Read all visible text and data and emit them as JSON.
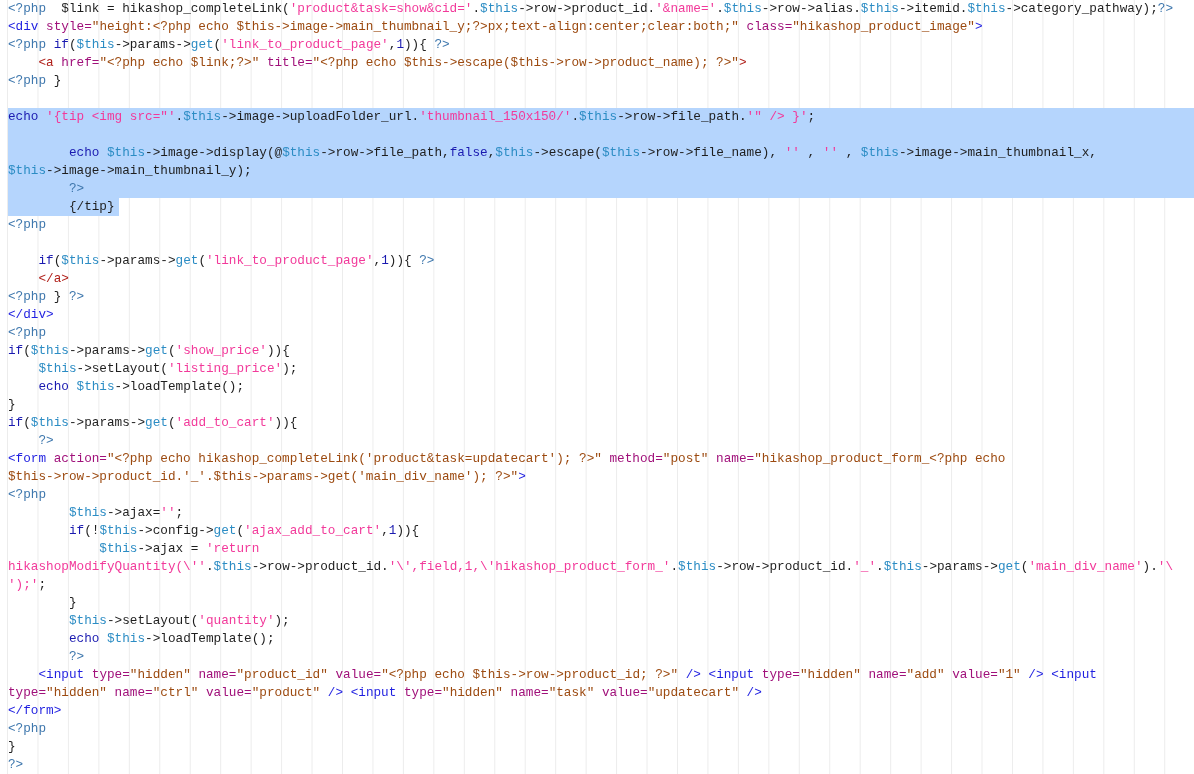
{
  "editor": {
    "lines": [
      {
        "selected": false,
        "tokens": [
          {
            "kind": "php",
            "text": "<?php"
          },
          {
            "kind": "plain",
            "text": "  $link = hikashop_completeLink("
          },
          {
            "kind": "string",
            "text": "'product&task=show&cid='"
          },
          {
            "kind": "plain",
            "text": "."
          },
          {
            "kind": "variable",
            "text": "$this"
          },
          {
            "kind": "plain",
            "text": "->row->product_id."
          },
          {
            "kind": "string",
            "text": "'&name='"
          },
          {
            "kind": "plain",
            "text": "."
          },
          {
            "kind": "variable",
            "text": "$this"
          },
          {
            "kind": "plain",
            "text": "->row->alias."
          },
          {
            "kind": "variable",
            "text": "$this"
          },
          {
            "kind": "plain",
            "text": "->itemid."
          },
          {
            "kind": "variable",
            "text": "$this"
          },
          {
            "kind": "plain",
            "text": "->category_pathway);"
          },
          {
            "kind": "php",
            "text": "?>"
          }
        ]
      },
      {
        "selected": false,
        "tokens": [
          {
            "kind": "tag",
            "text": "<div "
          },
          {
            "kind": "attr",
            "text": "style="
          },
          {
            "kind": "value",
            "text": "\"height:<?php echo $this->image->main_thumbnail_y;?>px;text-align:center;clear:both;\" "
          },
          {
            "kind": "attr",
            "text": "class="
          },
          {
            "kind": "value",
            "text": "\"hikashop_product_image\""
          },
          {
            "kind": "tag",
            "text": ">"
          }
        ]
      },
      {
        "selected": false,
        "tokens": [
          {
            "kind": "php",
            "text": "<?php "
          },
          {
            "kind": "keyword",
            "text": "if"
          },
          {
            "kind": "plain",
            "text": "("
          },
          {
            "kind": "variable",
            "text": "$this"
          },
          {
            "kind": "plain",
            "text": "->params->"
          },
          {
            "kind": "func",
            "text": "get"
          },
          {
            "kind": "plain",
            "text": "("
          },
          {
            "kind": "string",
            "text": "'link_to_product_page'"
          },
          {
            "kind": "plain",
            "text": ","
          },
          {
            "kind": "number",
            "text": "1"
          },
          {
            "kind": "plain",
            "text": ")){ "
          },
          {
            "kind": "php",
            "text": "?>"
          }
        ]
      },
      {
        "selected": false,
        "tokens": [
          {
            "kind": "anchor",
            "text": "    <a "
          },
          {
            "kind": "attr",
            "text": "href="
          },
          {
            "kind": "value",
            "text": "\"<?php echo $link;?>\" "
          },
          {
            "kind": "attr",
            "text": "title="
          },
          {
            "kind": "value",
            "text": "\"<?php echo $this->escape($this->row->product_name); ?>\""
          },
          {
            "kind": "anchor",
            "text": ">"
          }
        ]
      },
      {
        "selected": false,
        "tokens": [
          {
            "kind": "php",
            "text": "<?php"
          },
          {
            "kind": "plain",
            "text": " }"
          }
        ]
      },
      {
        "kind": "blank"
      },
      {
        "selected": true,
        "tokens": [
          {
            "kind": "keyword",
            "text": "echo "
          },
          {
            "kind": "string",
            "text": "'{tip <img src=\"'"
          },
          {
            "kind": "plain",
            "text": "."
          },
          {
            "kind": "variable",
            "text": "$this"
          },
          {
            "kind": "plain",
            "text": "->image->uploadFolder_url."
          },
          {
            "kind": "string",
            "text": "'thumbnail_150x150/'"
          },
          {
            "kind": "plain",
            "text": "."
          },
          {
            "kind": "variable",
            "text": "$this"
          },
          {
            "kind": "plain",
            "text": "->row->file_path."
          },
          {
            "kind": "string",
            "text": "'\" /> }'"
          },
          {
            "kind": "plain",
            "text": ";"
          }
        ]
      },
      {
        "kind": "blank",
        "selected": true
      },
      {
        "selected": true,
        "tokens": [
          {
            "kind": "keyword",
            "text": "        echo "
          },
          {
            "kind": "variable",
            "text": "$this"
          },
          {
            "kind": "plain",
            "text": "->image->display(@"
          },
          {
            "kind": "variable",
            "text": "$this"
          },
          {
            "kind": "plain",
            "text": "->row->file_path,"
          },
          {
            "kind": "keyword",
            "text": "false"
          },
          {
            "kind": "plain",
            "text": ","
          },
          {
            "kind": "variable",
            "text": "$this"
          },
          {
            "kind": "plain",
            "text": "->escape("
          },
          {
            "kind": "variable",
            "text": "$this"
          },
          {
            "kind": "plain",
            "text": "->row->file_name), "
          },
          {
            "kind": "string",
            "text": "''"
          },
          {
            "kind": "plain",
            "text": " , "
          },
          {
            "kind": "string",
            "text": "''"
          },
          {
            "kind": "plain",
            "text": " , "
          },
          {
            "kind": "variable",
            "text": "$this"
          },
          {
            "kind": "plain",
            "text": "->image->main_thumbnail_x,"
          }
        ]
      },
      {
        "selected": true,
        "tokens": [
          {
            "kind": "variable",
            "text": "$this"
          },
          {
            "kind": "plain",
            "text": "->image->main_thumbnail_y);"
          }
        ]
      },
      {
        "selected": true,
        "tokens": [
          {
            "kind": "php",
            "text": "        ?>"
          }
        ]
      },
      {
        "selected": true,
        "tokens": [
          {
            "kind": "plain",
            "text": "        {/tip}"
          }
        ]
      },
      {
        "selected": false,
        "tokens": [
          {
            "kind": "php",
            "text": "<?php"
          }
        ]
      },
      {
        "kind": "blank"
      },
      {
        "selected": false,
        "tokens": [
          {
            "kind": "keyword",
            "text": "    if"
          },
          {
            "kind": "plain",
            "text": "("
          },
          {
            "kind": "variable",
            "text": "$this"
          },
          {
            "kind": "plain",
            "text": "->params->"
          },
          {
            "kind": "func",
            "text": "get"
          },
          {
            "kind": "plain",
            "text": "("
          },
          {
            "kind": "string",
            "text": "'link_to_product_page'"
          },
          {
            "kind": "plain",
            "text": ","
          },
          {
            "kind": "number",
            "text": "1"
          },
          {
            "kind": "plain",
            "text": ")){ "
          },
          {
            "kind": "php",
            "text": "?>"
          }
        ]
      },
      {
        "selected": false,
        "tokens": [
          {
            "kind": "anchor",
            "text": "    </a>"
          }
        ]
      },
      {
        "selected": false,
        "tokens": [
          {
            "kind": "php",
            "text": "<?php"
          },
          {
            "kind": "plain",
            "text": " } "
          },
          {
            "kind": "php",
            "text": "?>"
          }
        ]
      },
      {
        "selected": false,
        "tokens": [
          {
            "kind": "tag",
            "text": "</div>"
          }
        ]
      },
      {
        "selected": false,
        "tokens": [
          {
            "kind": "php",
            "text": "<?php"
          }
        ]
      },
      {
        "selected": false,
        "tokens": [
          {
            "kind": "keyword",
            "text": "if"
          },
          {
            "kind": "plain",
            "text": "("
          },
          {
            "kind": "variable",
            "text": "$this"
          },
          {
            "kind": "plain",
            "text": "->params->"
          },
          {
            "kind": "func",
            "text": "get"
          },
          {
            "kind": "plain",
            "text": "("
          },
          {
            "kind": "string",
            "text": "'show_price'"
          },
          {
            "kind": "plain",
            "text": ")){"
          }
        ]
      },
      {
        "selected": false,
        "tokens": [
          {
            "kind": "variable",
            "text": "    $this"
          },
          {
            "kind": "plain",
            "text": "->setLayout("
          },
          {
            "kind": "string",
            "text": "'listing_price'"
          },
          {
            "kind": "plain",
            "text": ");"
          }
        ]
      },
      {
        "selected": false,
        "tokens": [
          {
            "kind": "keyword",
            "text": "    echo "
          },
          {
            "kind": "variable",
            "text": "$this"
          },
          {
            "kind": "plain",
            "text": "->loadTemplate();"
          }
        ]
      },
      {
        "selected": false,
        "tokens": [
          {
            "kind": "plain",
            "text": "}"
          }
        ]
      },
      {
        "selected": false,
        "tokens": [
          {
            "kind": "keyword",
            "text": "if"
          },
          {
            "kind": "plain",
            "text": "("
          },
          {
            "kind": "variable",
            "text": "$this"
          },
          {
            "kind": "plain",
            "text": "->params->"
          },
          {
            "kind": "func",
            "text": "get"
          },
          {
            "kind": "plain",
            "text": "("
          },
          {
            "kind": "string",
            "text": "'add_to_cart'"
          },
          {
            "kind": "plain",
            "text": ")){"
          }
        ]
      },
      {
        "selected": false,
        "tokens": [
          {
            "kind": "php",
            "text": "    ?>"
          }
        ]
      },
      {
        "selected": false,
        "tokens": [
          {
            "kind": "tag",
            "text": "<form "
          },
          {
            "kind": "attr",
            "text": "action="
          },
          {
            "kind": "value",
            "text": "\"<?php echo hikashop_completeLink('product&task=updatecart'); ?>\" "
          },
          {
            "kind": "attr",
            "text": "method="
          },
          {
            "kind": "value",
            "text": "\"post\" "
          },
          {
            "kind": "attr",
            "text": "name="
          },
          {
            "kind": "value",
            "text": "\"hikashop_product_form_<?php echo"
          }
        ]
      },
      {
        "selected": false,
        "tokens": [
          {
            "kind": "value",
            "text": "$this->row->product_id.'_'.$this->params->get('main_div_name'); ?>\""
          },
          {
            "kind": "tag",
            "text": ">"
          }
        ]
      },
      {
        "selected": false,
        "tokens": [
          {
            "kind": "php",
            "text": "<?php"
          }
        ]
      },
      {
        "selected": false,
        "tokens": [
          {
            "kind": "variable",
            "text": "        $this"
          },
          {
            "kind": "plain",
            "text": "->ajax="
          },
          {
            "kind": "string",
            "text": "''"
          },
          {
            "kind": "plain",
            "text": ";"
          }
        ]
      },
      {
        "selected": false,
        "tokens": [
          {
            "kind": "keyword",
            "text": "        if"
          },
          {
            "kind": "plain",
            "text": "(!"
          },
          {
            "kind": "variable",
            "text": "$this"
          },
          {
            "kind": "plain",
            "text": "->config->"
          },
          {
            "kind": "func",
            "text": "get"
          },
          {
            "kind": "plain",
            "text": "("
          },
          {
            "kind": "string",
            "text": "'ajax_add_to_cart'"
          },
          {
            "kind": "plain",
            "text": ","
          },
          {
            "kind": "number",
            "text": "1"
          },
          {
            "kind": "plain",
            "text": ")){"
          }
        ]
      },
      {
        "selected": false,
        "tokens": [
          {
            "kind": "variable",
            "text": "            $this"
          },
          {
            "kind": "plain",
            "text": "->ajax = "
          },
          {
            "kind": "string",
            "text": "'return"
          }
        ]
      },
      {
        "selected": false,
        "tokens": [
          {
            "kind": "string",
            "text": "hikashopModifyQuantity(\\''"
          },
          {
            "kind": "plain",
            "text": "."
          },
          {
            "kind": "variable",
            "text": "$this"
          },
          {
            "kind": "plain",
            "text": "->row->product_id."
          },
          {
            "kind": "string",
            "text": "'\\',field,1,\\'hikashop_product_form_'"
          },
          {
            "kind": "plain",
            "text": "."
          },
          {
            "kind": "variable",
            "text": "$this"
          },
          {
            "kind": "plain",
            "text": "->row->product_id."
          },
          {
            "kind": "string",
            "text": "'_'"
          },
          {
            "kind": "plain",
            "text": "."
          },
          {
            "kind": "variable",
            "text": "$this"
          },
          {
            "kind": "plain",
            "text": "->params->"
          },
          {
            "kind": "func",
            "text": "get"
          },
          {
            "kind": "plain",
            "text": "("
          },
          {
            "kind": "string",
            "text": "'main_div_name'"
          },
          {
            "kind": "plain",
            "text": ")."
          },
          {
            "kind": "string",
            "text": "'\\"
          }
        ]
      },
      {
        "selected": false,
        "tokens": [
          {
            "kind": "string",
            "text": "');'"
          },
          {
            "kind": "plain",
            "text": ";"
          }
        ]
      },
      {
        "selected": false,
        "tokens": [
          {
            "kind": "plain",
            "text": "        }"
          }
        ]
      },
      {
        "selected": false,
        "tokens": [
          {
            "kind": "variable",
            "text": "        $this"
          },
          {
            "kind": "plain",
            "text": "->setLayout("
          },
          {
            "kind": "string",
            "text": "'quantity'"
          },
          {
            "kind": "plain",
            "text": ");"
          }
        ]
      },
      {
        "selected": false,
        "tokens": [
          {
            "kind": "keyword",
            "text": "        echo "
          },
          {
            "kind": "variable",
            "text": "$this"
          },
          {
            "kind": "plain",
            "text": "->loadTemplate();"
          }
        ]
      },
      {
        "selected": false,
        "tokens": [
          {
            "kind": "php",
            "text": "        ?>"
          }
        ]
      },
      {
        "selected": false,
        "tokens": [
          {
            "kind": "tag",
            "text": "    <input "
          },
          {
            "kind": "attr",
            "text": "type="
          },
          {
            "kind": "value",
            "text": "\"hidden\" "
          },
          {
            "kind": "attr",
            "text": "name="
          },
          {
            "kind": "value",
            "text": "\"product_id\" "
          },
          {
            "kind": "attr",
            "text": "value="
          },
          {
            "kind": "value",
            "text": "\"<?php echo $this->row->product_id; ?>\" "
          },
          {
            "kind": "tag",
            "text": "/> <input "
          },
          {
            "kind": "attr",
            "text": "type="
          },
          {
            "kind": "value",
            "text": "\"hidden\" "
          },
          {
            "kind": "attr",
            "text": "name="
          },
          {
            "kind": "value",
            "text": "\"add\" "
          },
          {
            "kind": "attr",
            "text": "value="
          },
          {
            "kind": "value",
            "text": "\"1\" "
          },
          {
            "kind": "tag",
            "text": "/> <input"
          }
        ]
      },
      {
        "selected": false,
        "tokens": [
          {
            "kind": "attr",
            "text": "type="
          },
          {
            "kind": "value",
            "text": "\"hidden\" "
          },
          {
            "kind": "attr",
            "text": "name="
          },
          {
            "kind": "value",
            "text": "\"ctrl\" "
          },
          {
            "kind": "attr",
            "text": "value="
          },
          {
            "kind": "value",
            "text": "\"product\" "
          },
          {
            "kind": "tag",
            "text": "/> <input "
          },
          {
            "kind": "attr",
            "text": "type="
          },
          {
            "kind": "value",
            "text": "\"hidden\" "
          },
          {
            "kind": "attr",
            "text": "name="
          },
          {
            "kind": "value",
            "text": "\"task\" "
          },
          {
            "kind": "attr",
            "text": "value="
          },
          {
            "kind": "value",
            "text": "\"updatecart\" "
          },
          {
            "kind": "tag",
            "text": "/>"
          }
        ]
      },
      {
        "selected": false,
        "tokens": [
          {
            "kind": "tag",
            "text": "</form>"
          }
        ]
      },
      {
        "selected": false,
        "tokens": [
          {
            "kind": "php",
            "text": "<?php"
          }
        ]
      },
      {
        "selected": false,
        "tokens": [
          {
            "kind": "plain",
            "text": "}"
          }
        ]
      },
      {
        "selected": false,
        "tokens": [
          {
            "kind": "php",
            "text": "?>"
          }
        ]
      }
    ]
  }
}
